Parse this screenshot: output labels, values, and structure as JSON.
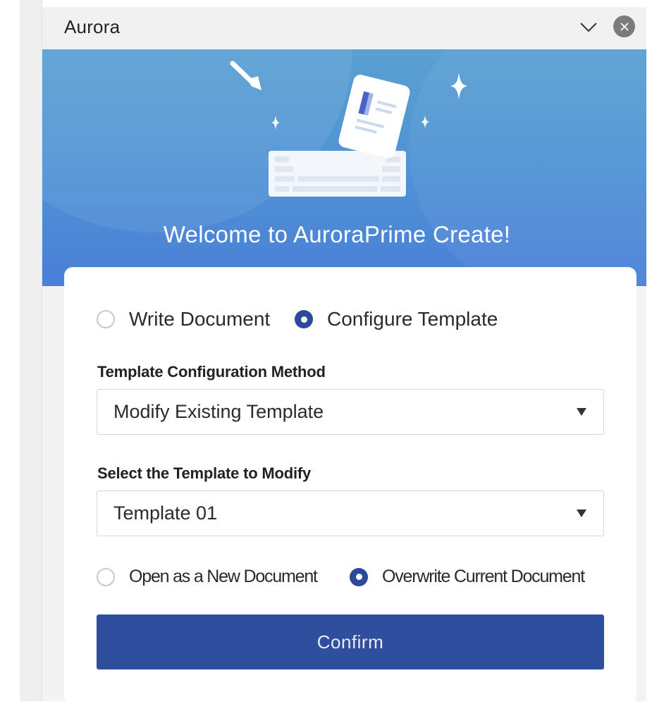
{
  "window": {
    "title": "Aurora",
    "collapse_icon": "chevron-down-icon",
    "close_icon": "close-icon"
  },
  "hero": {
    "welcome_text": "Welcome to AuroraPrime Create!",
    "illustration": "document-keyboard-illustration"
  },
  "mode": {
    "options": [
      {
        "label": "Write Document",
        "selected": false
      },
      {
        "label": "Configure Template",
        "selected": true
      }
    ]
  },
  "config_method": {
    "label": "Template Configuration Method",
    "selected": "Modify Existing Template"
  },
  "template_select": {
    "label": "Select the Template to Modify",
    "selected": "Template 01"
  },
  "open_mode": {
    "options": [
      {
        "label": "Open as a New Document",
        "selected": false
      },
      {
        "label": "Overwrite Current Document",
        "selected": true
      }
    ]
  },
  "confirm_label": "Confirm",
  "colors": {
    "accent": "#2f4e9e",
    "hero_top": "#5aa0d2",
    "hero_bottom": "#4a7fd8"
  }
}
